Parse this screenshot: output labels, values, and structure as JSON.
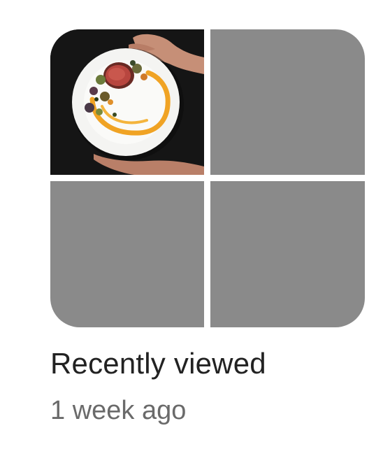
{
  "wishlist": {
    "title": "Recently viewed",
    "subtitle": "1 week ago",
    "thumbnail_subject": "plated-dish-photo",
    "placeholder_color": "#8a8a8a"
  }
}
